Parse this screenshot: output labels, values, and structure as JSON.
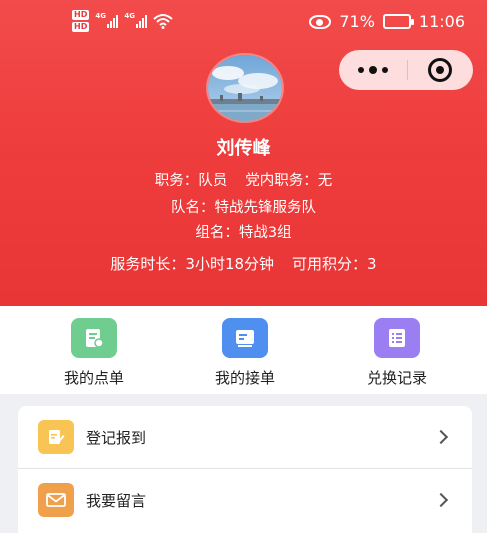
{
  "status_bar": {
    "hd_top": "HD",
    "hd_bottom": "HD",
    "sim1_badge": "1",
    "sim2_badge": "2",
    "net1": "4G",
    "net2": "4G",
    "battery_percent": "71%",
    "battery_level": 0.71,
    "time": "11:06",
    "icons": [
      "hd-icon",
      "signal-icon",
      "wifi-icon",
      "eye-icon",
      "battery-icon"
    ]
  },
  "mini_program_capsule": {
    "icons": [
      "more-dots-icon",
      "close-target-icon"
    ]
  },
  "profile": {
    "name": "刘传峰",
    "role": "职务：队员",
    "party_role": "党内职务：无",
    "team": "队名：特战先锋服务队",
    "group": "组名：特战3组",
    "service_hours": "服务时长：3小时18分钟",
    "points": "可用积分：3"
  },
  "quick_actions": [
    {
      "label": "我的点单",
      "color": "#6fcd8f",
      "icon": "order-doc-icon"
    },
    {
      "label": "我的接单",
      "color": "#4f8ff0",
      "icon": "accept-doc-icon"
    },
    {
      "label": "兑换记录",
      "color": "#9b7ff2",
      "icon": "record-list-icon"
    }
  ],
  "menu": [
    {
      "label": "登记报到",
      "color": "#f8c453",
      "icon": "register-edit-icon"
    },
    {
      "label": "我要留言",
      "color": "#f0a04b",
      "icon": "message-envelope-icon"
    }
  ],
  "colors": {
    "header_red": "#ee3b3b",
    "white": "#ffffff",
    "page_bg": "#eef0f3"
  }
}
